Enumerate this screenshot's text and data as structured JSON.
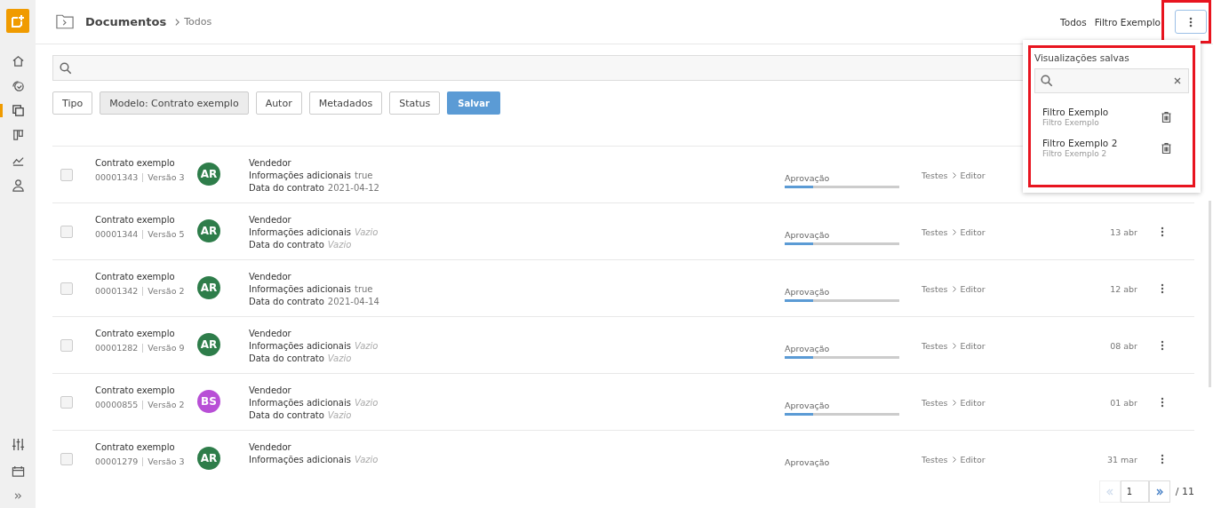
{
  "header": {
    "title": "Documentos",
    "breadcrumb": "Todos",
    "views": [
      "Todos",
      "Filtro Exemplo"
    ]
  },
  "filters": [
    {
      "label": "Tipo",
      "active": false
    },
    {
      "label": "Modelo: Contrato exemplo",
      "active": true
    },
    {
      "label": "Autor",
      "active": false
    },
    {
      "label": "Metadados",
      "active": false
    },
    {
      "label": "Status",
      "active": false
    }
  ],
  "save_button": "Salvar",
  "rows": [
    {
      "checked": false,
      "title": "Contrato exemplo",
      "number": "00001343",
      "version": "Versão 3",
      "initials": "AR",
      "color": "#2e7d4a",
      "fields": [
        {
          "label": "Vendedor"
        },
        {
          "label": "Informações adicionais",
          "value": "true",
          "empty": false
        },
        {
          "label": "Data do contrato",
          "value": "2021-04-12",
          "empty": false
        }
      ],
      "stage": "Aprovação",
      "level": 0.25,
      "path": [
        "Testes",
        "Editor"
      ]
    },
    {
      "checked": false,
      "title": "Contrato exemplo",
      "number": "00001344",
      "version": "Versão 5",
      "initials": "AR",
      "color": "#2e7d4a",
      "fields": [
        {
          "label": "Vendedor"
        },
        {
          "label": "Informações adicionais",
          "value": "Vazio",
          "empty": true
        },
        {
          "label": "Data do contrato",
          "value": "Vazio",
          "empty": true
        }
      ],
      "stage": "Aprovação",
      "level": 0.25,
      "path": [
        "Testes",
        "Editor"
      ],
      "date": "13 abr"
    },
    {
      "checked": false,
      "title": "Contrato exemplo",
      "number": "00001342",
      "version": "Versão 2",
      "initials": "AR",
      "color": "#2e7d4a",
      "fields": [
        {
          "label": "Vendedor"
        },
        {
          "label": "Informações adicionais",
          "value": "true",
          "empty": false
        },
        {
          "label": "Data do contrato",
          "value": "2021-04-14",
          "empty": false
        }
      ],
      "stage": "Aprovação",
      "level": 0.25,
      "path": [
        "Testes",
        "Editor"
      ],
      "date": "12 abr"
    },
    {
      "checked": false,
      "title": "Contrato exemplo",
      "number": "00001282",
      "version": "Versão 9",
      "initials": "AR",
      "color": "#2e7d4a",
      "fields": [
        {
          "label": "Vendedor"
        },
        {
          "label": "Informações adicionais",
          "value": "Vazio",
          "empty": true
        },
        {
          "label": "Data do contrato",
          "value": "Vazio",
          "empty": true
        }
      ],
      "stage": "Aprovação",
      "level": 0.25,
      "path": [
        "Testes",
        "Editor"
      ],
      "date": "08 abr"
    },
    {
      "checked": false,
      "title": "Contrato exemplo",
      "number": "00000855",
      "version": "Versão 2",
      "initials": "BS",
      "color": "#b84fd6",
      "fields": [
        {
          "label": "Vendedor"
        },
        {
          "label": "Informações adicionais",
          "value": "Vazio",
          "empty": true
        },
        {
          "label": "Data do contrato",
          "value": "Vazio",
          "empty": true
        }
      ],
      "stage": "Aprovação",
      "level": 0.25,
      "path": [
        "Testes",
        "Editor"
      ],
      "date": "01 abr"
    },
    {
      "checked": false,
      "title": "Contrato exemplo",
      "number": "00001279",
      "version": "Versão 3",
      "initials": "AR",
      "color": "#2e7d4a",
      "fields": [
        {
          "label": "Vendedor"
        },
        {
          "label": "Informações adicionais",
          "value": "Vazio",
          "empty": true
        }
      ],
      "stage": "Aprovação",
      "path": [
        "Testes",
        "Editor"
      ],
      "date": "31 mar"
    }
  ],
  "pagination": {
    "page": "1",
    "total": "/ 11",
    "prev_disabled": true
  },
  "saved_views": {
    "title": "Visualizações salvas",
    "items": [
      {
        "name": "Filtro Exemplo",
        "sub": "Filtro Exemplo"
      },
      {
        "name": "Filtro Exemplo 2",
        "sub": "Filtro Exemplo 2"
      }
    ]
  }
}
